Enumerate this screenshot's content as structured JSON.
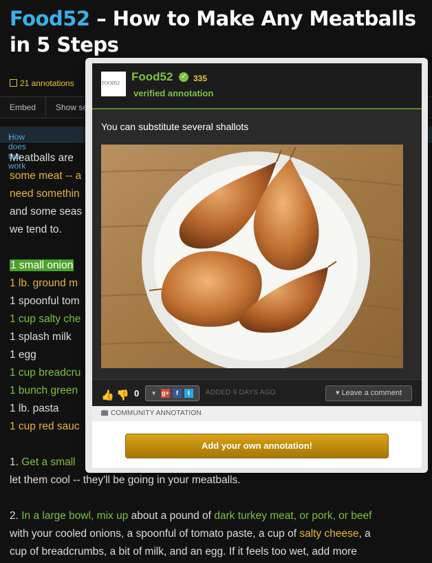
{
  "article": {
    "title_brand": "Food52",
    "title_rest": " – How to Make Any Meatballs in 5 Steps",
    "annotations": "21 annotations",
    "embed": "Embed",
    "show": "Show se",
    "how": "How does this work",
    "lines": {
      "l1": "Meatballs are ",
      "l2": "some meat -- a",
      "l3": "need somethin",
      "l4": "and some seas",
      "l5": "we tend to."
    },
    "ingredients": {
      "i1": "1 small onion",
      "i2": "1 lb. ground m",
      "i3": "1 spoonful tom",
      "i4": "1 cup salty che",
      "i5": "1 splash milk",
      "i6": "1 egg",
      "i7": "1 cup breadcru",
      "i8": "1 bunch green",
      "i9": "1 lb. pasta",
      "i10": "1 cup red sauc"
    },
    "step1": {
      "num": "1. ",
      "green": "Get a small",
      "line2": "let them cool -- they'll be going in your meatballs."
    },
    "step2": {
      "num": "2. ",
      "a": "In a large bowl, mix up",
      "b": " about a pound of ",
      "c": "dark turkey meat, or pork, or beef",
      "d": "with your cooled onions, a spoonful of tomato paste, a cup of ",
      "e": "salty cheese",
      "f": ", a",
      "g": "cup of breadcrumbs, a bit of milk, and an egg. If it feels too wet, add more"
    }
  },
  "popup": {
    "avatar_text": "FOOD52",
    "name": "Food52",
    "score": "335",
    "verified": "verified annotation",
    "text": "You can substitute several shallots",
    "vote_count": "0",
    "added": "ADDED 9 DAYS AGO",
    "leave_comment": "Leave a comment",
    "community": "COMMUNITY ANNOTATION",
    "add_button": "Add your own annotation!"
  }
}
